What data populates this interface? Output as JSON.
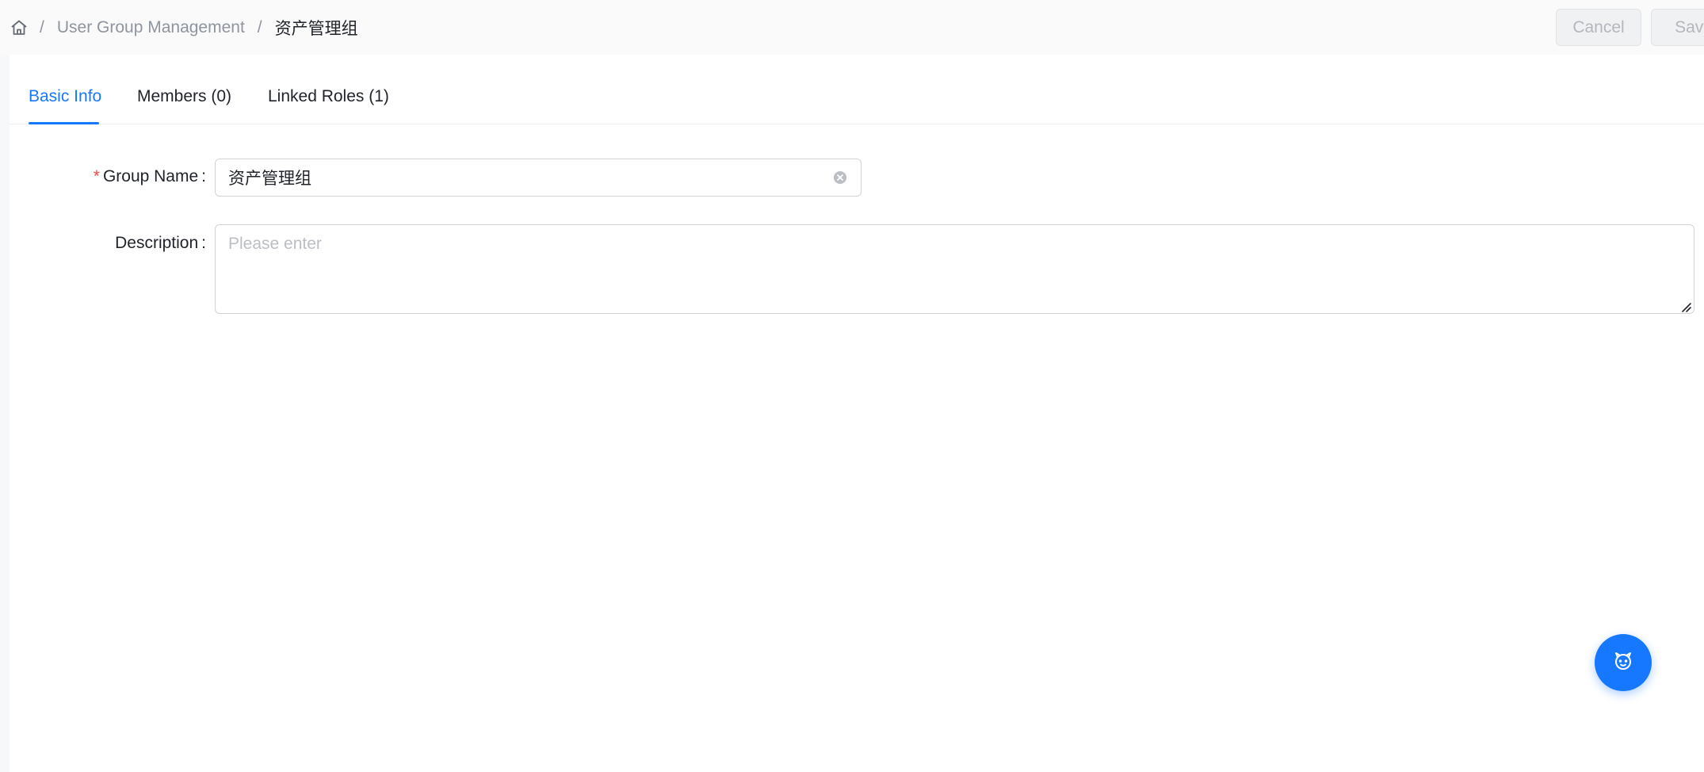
{
  "breadcrumb": {
    "home_icon": "home-icon",
    "separator": "/",
    "items": [
      "User Group Management",
      "资产管理组"
    ]
  },
  "actions": {
    "cancel_label": "Cancel",
    "save_label": "Save"
  },
  "tabs": [
    {
      "label": "Basic Info",
      "active": true
    },
    {
      "label": "Members (0)",
      "active": false
    },
    {
      "label": "Linked Roles (1)",
      "active": false
    }
  ],
  "form": {
    "group_name": {
      "label": "Group Name",
      "required_mark": "*",
      "colon": ":",
      "value": "资产管理组",
      "clear_icon": "close-circle-icon"
    },
    "description": {
      "label": "Description",
      "colon": ":",
      "placeholder": "Please enter",
      "value": ""
    }
  },
  "floating_button": {
    "icon": "assistant-face-icon"
  },
  "colors": {
    "accent": "#1677ff",
    "required": "#f54a45"
  }
}
